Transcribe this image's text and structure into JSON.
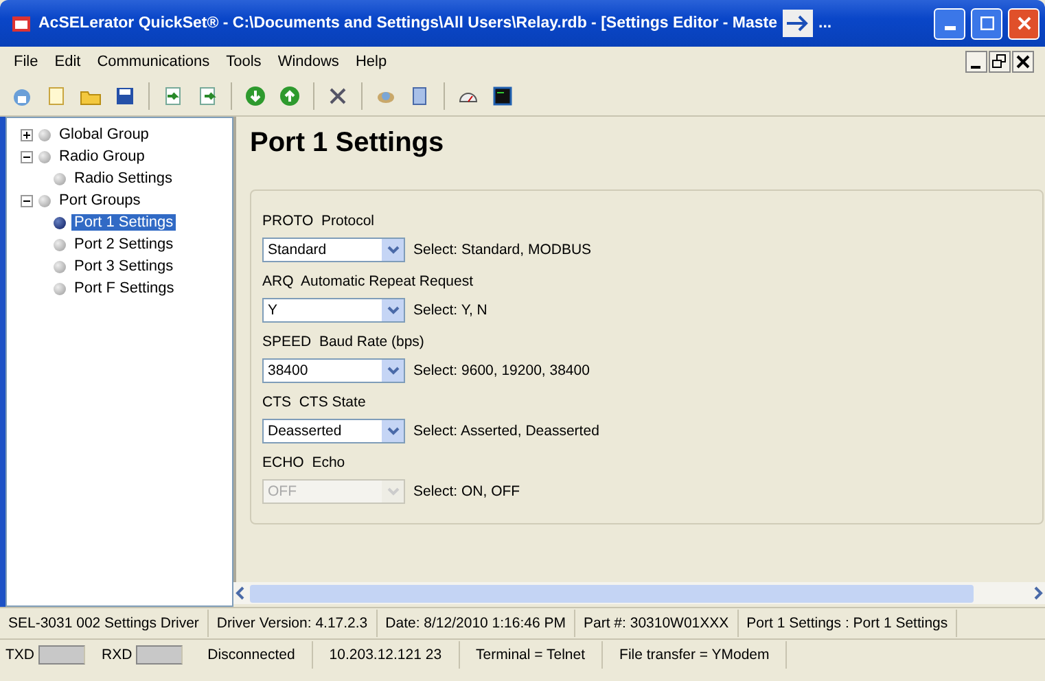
{
  "window": {
    "title": "AcSELerator QuickSet® - C:\\Documents and Settings\\All Users\\Relay.rdb - [Settings Editor - Maste",
    "title_tail": "..."
  },
  "menu": [
    "File",
    "Edit",
    "Communications",
    "Tools",
    "Windows",
    "Help"
  ],
  "tree": [
    {
      "label": "Global Group",
      "expanded": false,
      "selected": false
    },
    {
      "label": "Radio Group",
      "expanded": true,
      "selected": false,
      "children": [
        {
          "label": "Radio Settings",
          "selected": false
        }
      ]
    },
    {
      "label": "Port Groups",
      "expanded": true,
      "selected": false,
      "children": [
        {
          "label": "Port 1 Settings",
          "selected": true
        },
        {
          "label": "Port 2 Settings",
          "selected": false
        },
        {
          "label": "Port 3 Settings",
          "selected": false
        },
        {
          "label": "Port F Settings",
          "selected": false
        }
      ]
    }
  ],
  "page_title": "Port 1 Settings",
  "settings": [
    {
      "code": "PROTO",
      "label": "Protocol",
      "value": "Standard",
      "options": "Select: Standard, MODBUS",
      "disabled": false
    },
    {
      "code": "ARQ",
      "label": "Automatic Repeat Request",
      "value": "Y",
      "options": "Select: Y, N",
      "disabled": false
    },
    {
      "code": "SPEED",
      "label": "Baud Rate (bps)",
      "value": "38400",
      "options": "Select: 9600, 19200, 38400",
      "disabled": false
    },
    {
      "code": "CTS",
      "label": "CTS State",
      "value": "Deasserted",
      "options": "Select: Asserted, Deasserted",
      "disabled": false
    },
    {
      "code": "ECHO",
      "label": "Echo",
      "value": "OFF",
      "options": "Select: ON, OFF",
      "disabled": true
    }
  ],
  "status_bar": [
    "SEL-3031 002 Settings Driver",
    "Driver Version: 4.17.2.3",
    "Date: 8/12/2010 1:16:46 PM",
    "Part #: 30310W01XXX",
    "Port 1 Settings : Port 1 Settings"
  ],
  "comm_bar": {
    "txd": "TXD",
    "rxd": "RXD",
    "items": [
      "Disconnected",
      "10.203.12.121  23",
      "Terminal = Telnet",
      "File transfer = YModem"
    ]
  }
}
